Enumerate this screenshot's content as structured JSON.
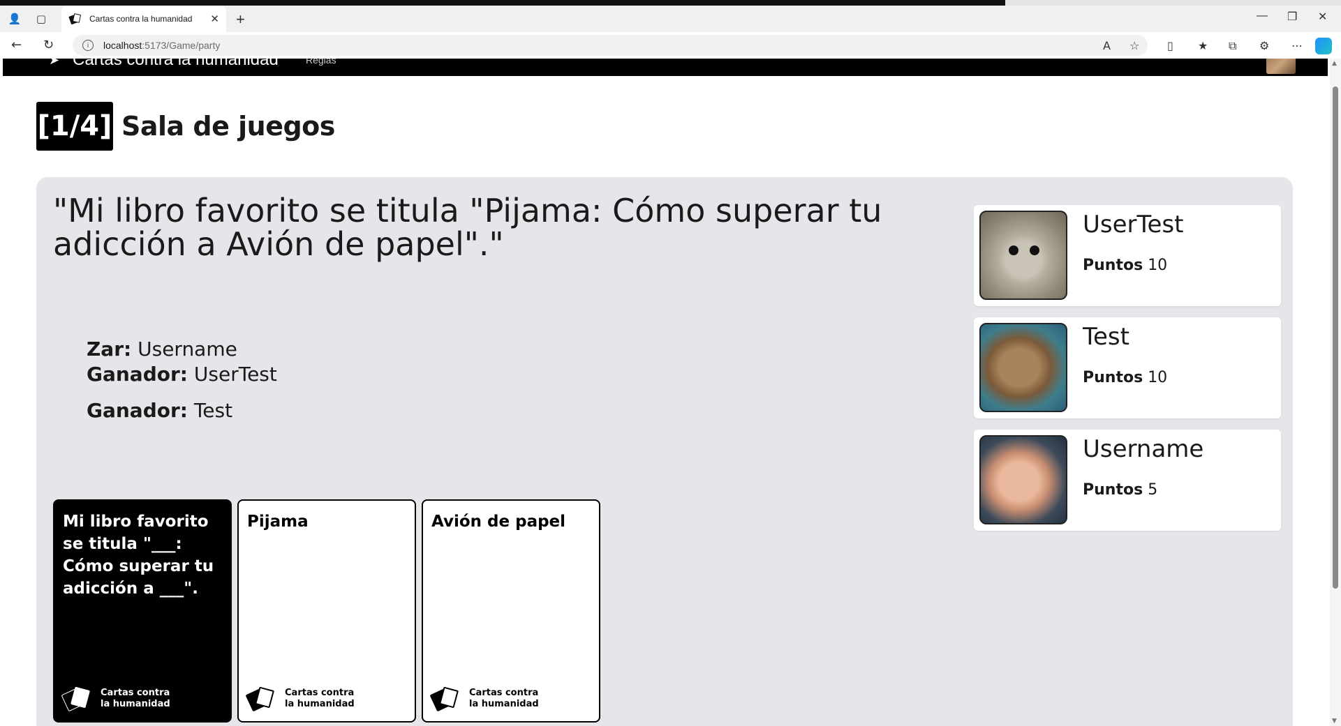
{
  "browser": {
    "tab_title": "Cartas contra la humanidad",
    "url_host": "localhost",
    "url_path": ":5173/Game/party"
  },
  "navbar": {
    "brand": "Cartas contra la humanidad",
    "rules_link": "Reglas"
  },
  "header": {
    "round": "[1/4]",
    "title": "Sala de juegos"
  },
  "question": "\"Mi libro favorito se titula \"Pijama: Cómo superar tu adicción a Avión de papel\".\"",
  "info": {
    "zar_label": "Zar:",
    "zar_value": "Username",
    "winner1_label": "Ganador:",
    "winner1_value": "UserTest",
    "winner2_label": "Ganador:",
    "winner2_value": "Test"
  },
  "cards": [
    {
      "text": "Mi libro favorito se titula \"___: Cómo superar tu adicción a ___\".",
      "brand_line1": "Cartas contra",
      "brand_line2": "la humanidad",
      "color": "black"
    },
    {
      "text": "Pijama",
      "brand_line1": "Cartas contra",
      "brand_line2": "la humanidad",
      "color": "white"
    },
    {
      "text": "Avión de papel",
      "brand_line1": "Cartas contra",
      "brand_line2": "la humanidad",
      "color": "white"
    }
  ],
  "players": [
    {
      "name": "UserTest",
      "points_label": "Puntos",
      "points": "10"
    },
    {
      "name": "Test",
      "points_label": "Puntos",
      "points": "10"
    },
    {
      "name": "Username",
      "points_label": "Puntos",
      "points": "5"
    }
  ],
  "colors": {
    "panel_bg": "#e5e6e9",
    "black_card": "#000000",
    "white_card": "#ffffff"
  }
}
